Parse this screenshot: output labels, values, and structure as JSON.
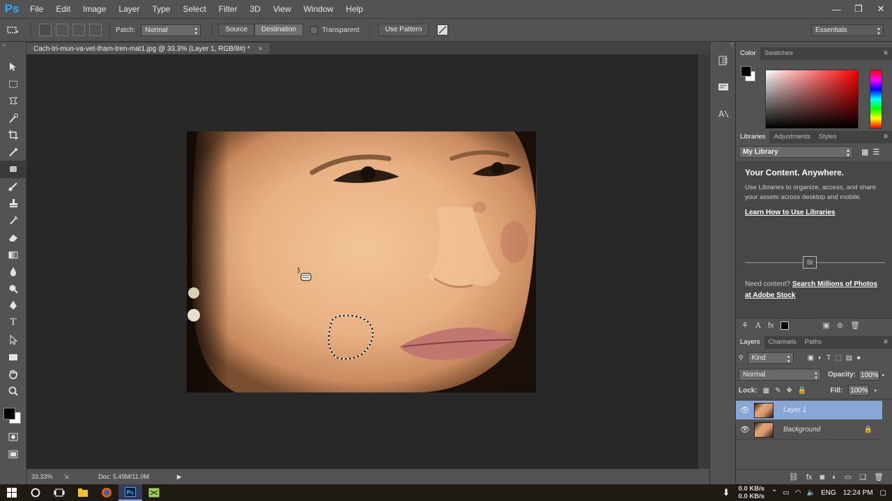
{
  "app": {
    "logo": "Ps"
  },
  "menu": [
    "File",
    "Edit",
    "Image",
    "Layer",
    "Type",
    "Select",
    "Filter",
    "3D",
    "View",
    "Window",
    "Help"
  ],
  "window_controls": {
    "minimize": "—",
    "restore": "❐",
    "close": "✕"
  },
  "options": {
    "patch_label": "Patch:",
    "patch_mode": "Normal",
    "source": "Source",
    "destination": "Destination",
    "transparent": "Transparent",
    "use_pattern": "Use Pattern",
    "workspace": "Essentials"
  },
  "document": {
    "tab_title": "Cach-tri-mun-va-vet-tham-tren-mat1.jpg @ 33.3% (Layer 1, RGB/8#) *",
    "tab_close": "×",
    "zoom": "33.33%",
    "doc_size": "Doc: 5.49M/11.0M"
  },
  "color_panel": {
    "tabs": [
      "Color",
      "Swatches"
    ],
    "active": "Color"
  },
  "libraries_panel": {
    "tabs": [
      "Libraries",
      "Adjustments",
      "Styles"
    ],
    "library_select": "My Library",
    "title": "Your Content. Anywhere.",
    "body": "Use Libraries to organize, access, and share your assets across desktop and mobile.",
    "learn_link": "Learn How to Use Libraries",
    "stock_badge": "St",
    "need_content": "Need content?",
    "stock_link": "Search Millions of Photos at Adobe Stock"
  },
  "layers_panel": {
    "tabs": [
      "Layers",
      "Channels",
      "Paths"
    ],
    "filter": "Kind",
    "blend_mode": "Normal",
    "opacity_label": "Opacity:",
    "opacity_value": "100%",
    "lock_label": "Lock:",
    "fill_label": "Fill:",
    "fill_value": "100%",
    "layers": [
      {
        "name": "Layer 1",
        "selected": true
      },
      {
        "name": "Background",
        "selected": false,
        "locked": true
      }
    ]
  },
  "taskbar": {
    "net_up": "0.0 KB/s",
    "net_down": "0.0 KB/s",
    "language": "ENG",
    "time": "12:24 PM"
  },
  "colors": {
    "accent": "#31a8ff",
    "selected_layer": "#88a7d6",
    "ui_gray": "#535353",
    "canvas_bg": "#282828"
  }
}
